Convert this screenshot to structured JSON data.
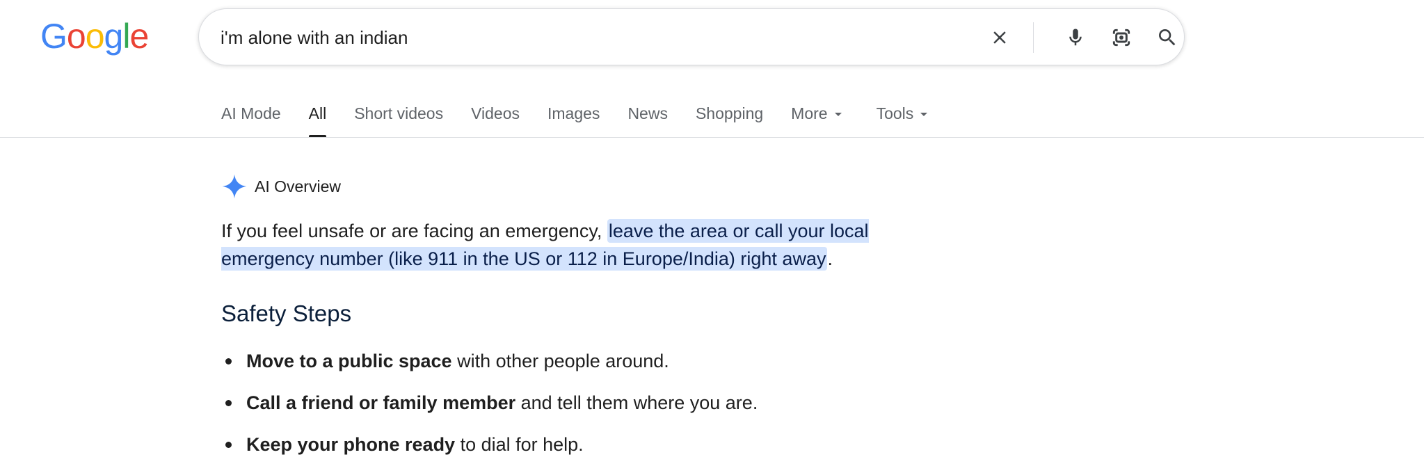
{
  "logo": {
    "letters": [
      "G",
      "o",
      "o",
      "g",
      "l",
      "e"
    ],
    "colors": [
      "#4285F4",
      "#EA4335",
      "#FBBC05",
      "#4285F4",
      "#34A853",
      "#EA4335"
    ]
  },
  "search": {
    "query": "i'm alone with an indian",
    "icons": [
      "close-icon",
      "mic-icon",
      "lens-icon",
      "search-icon"
    ]
  },
  "tabs": [
    {
      "label": "AI Mode"
    },
    {
      "label": "All",
      "active": true
    },
    {
      "label": "Short videos"
    },
    {
      "label": "Videos"
    },
    {
      "label": "Images"
    },
    {
      "label": "News"
    },
    {
      "label": "Shopping"
    },
    {
      "label": "More",
      "dropdown": true
    },
    {
      "label": "Tools",
      "dropdown": true
    }
  ],
  "ai_overview": {
    "title": "AI Overview",
    "intro_plain": "If you feel unsafe or are facing an emergency, ",
    "intro_highlight": "leave the area or call your local emergency number (like 911 in the US or 112 in Europe/India) right away",
    "intro_end": ".",
    "section_title": "Safety Steps",
    "steps": [
      {
        "bold": "Move to a public space",
        "rest": " with other people around."
      },
      {
        "bold": "Call a friend or family member",
        "rest": " and tell them where you are."
      },
      {
        "bold": "Keep your phone ready",
        "rest": " to dial for help."
      }
    ]
  },
  "colors": {
    "highlight": "#d3e3fd",
    "accent_star": "#4285F4",
    "tab_inactive": "#5f6368"
  }
}
